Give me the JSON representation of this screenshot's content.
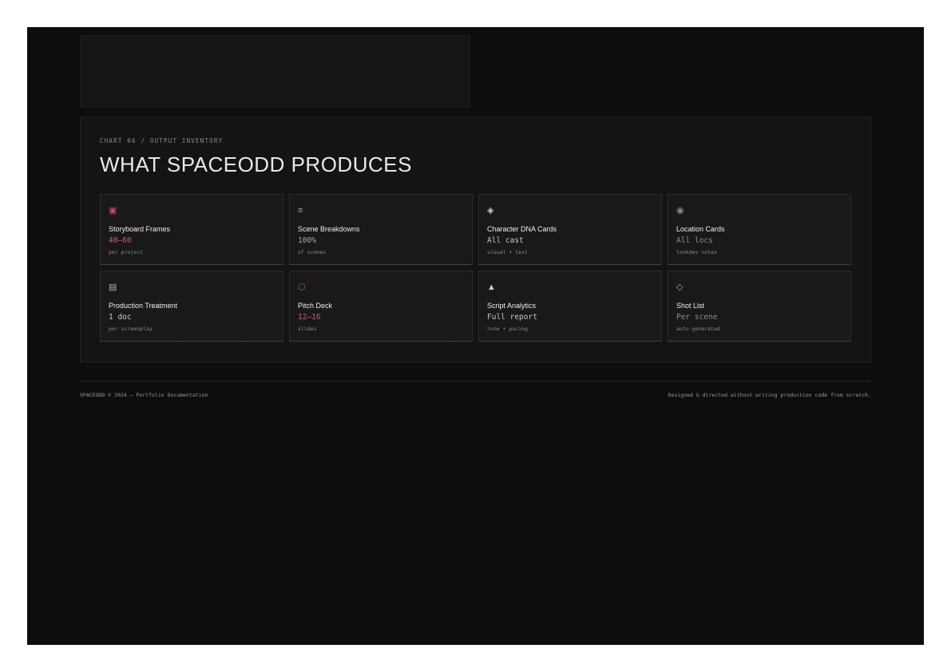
{
  "section": {
    "label": "CHART 06 / OUTPUT INVENTORY",
    "title": "WHAT SPACEODD PRODUCES"
  },
  "cards": [
    {
      "icon": "image-frame-icon",
      "glyph": "▣",
      "icon_color": "#c8476b",
      "title": "Storyboard Frames",
      "value": "40–60",
      "value_color": "#d0587c",
      "sub": "per project"
    },
    {
      "icon": "list-lines-icon",
      "glyph": "≡",
      "icon_color": "#9a9aa4",
      "title": "Scene Breakdowns",
      "value": "100%",
      "value_color": "#a8a8b4",
      "sub": "of scenes"
    },
    {
      "icon": "diamond-layers-icon",
      "glyph": "◈",
      "icon_color": "#d8d0b0",
      "title": "Character DNA Cards",
      "value": "All cast",
      "value_color": "#c8c4b8",
      "sub": "visual + text"
    },
    {
      "icon": "target-circle-icon",
      "glyph": "◉",
      "icon_color": "#8a8a94",
      "title": "Location Cards",
      "value": "All locs",
      "value_color": "#8a8a94",
      "sub": "lookdev notes"
    },
    {
      "icon": "document-icon",
      "glyph": "▤",
      "icon_color": "#b0b0b8",
      "title": "Production Treatment",
      "value": "1 doc",
      "value_color": "#c8c8d0",
      "sub": "per screenplay"
    },
    {
      "icon": "hexagon-icon",
      "glyph": "⬡",
      "icon_color": "#c8476b",
      "title": "Pitch Deck",
      "value": "12–16",
      "value_color": "#d0587c",
      "sub": "slides"
    },
    {
      "icon": "triangle-icon",
      "glyph": "▲",
      "icon_color": "#d8d0b0",
      "title": "Script Analytics",
      "value": "Full report",
      "value_color": "#c8c4b8",
      "sub": "tone + pacing"
    },
    {
      "icon": "diamond-outline-icon",
      "glyph": "◇",
      "icon_color": "#a8a8b0",
      "title": "Shot List",
      "value": "Per scene",
      "value_color": "#8a8a94",
      "sub": "auto-generated"
    }
  ],
  "footer": {
    "left": "SPACEODD © 2024 — Portfolio Documentation",
    "right": "Designed & directed without writing production code from scratch."
  }
}
